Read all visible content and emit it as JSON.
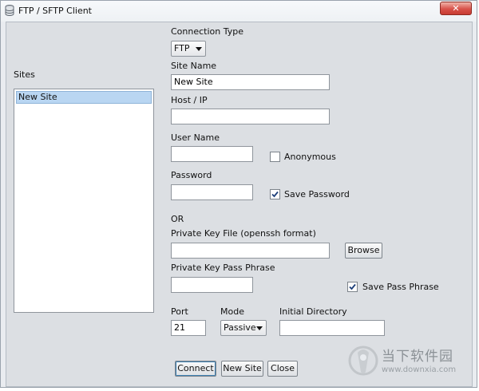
{
  "window": {
    "title": "FTP / SFTP Client",
    "close_label": "✕"
  },
  "sites": {
    "label": "Sites",
    "items": [
      "New Site"
    ]
  },
  "form": {
    "connection_type_label": "Connection Type",
    "connection_type_value": "FTP",
    "site_name_label": "Site Name",
    "site_name_value": "New Site",
    "host_label": "Host / IP",
    "host_value": "",
    "user_name_label": "User Name",
    "user_name_value": "",
    "anonymous_label": "Anonymous",
    "anonymous_checked": false,
    "password_label": "Password",
    "password_value": "",
    "save_password_label": "Save Password",
    "save_password_checked": true,
    "or_label": "OR",
    "private_key_file_label": "Private Key File (openssh format)",
    "private_key_file_value": "",
    "browse_label": "Browse",
    "pass_phrase_label": "Private Key Pass Phrase",
    "pass_phrase_value": "",
    "save_pass_phrase_label": "Save Pass Phrase",
    "save_pass_phrase_checked": true,
    "port_label": "Port",
    "port_value": "21",
    "mode_label": "Mode",
    "mode_value": "Passive",
    "initial_directory_label": "Initial Directory",
    "initial_directory_value": ""
  },
  "actions": {
    "connect_label": "Connect",
    "new_site_label": "New Site",
    "close_label": "Close"
  },
  "watermark": {
    "text": "当下软件园",
    "url": "www.downxia.com"
  },
  "colors": {
    "selection": "#b9d6f2",
    "dialog_bg": "#dcdfe3",
    "close_red": "#d8524a"
  }
}
